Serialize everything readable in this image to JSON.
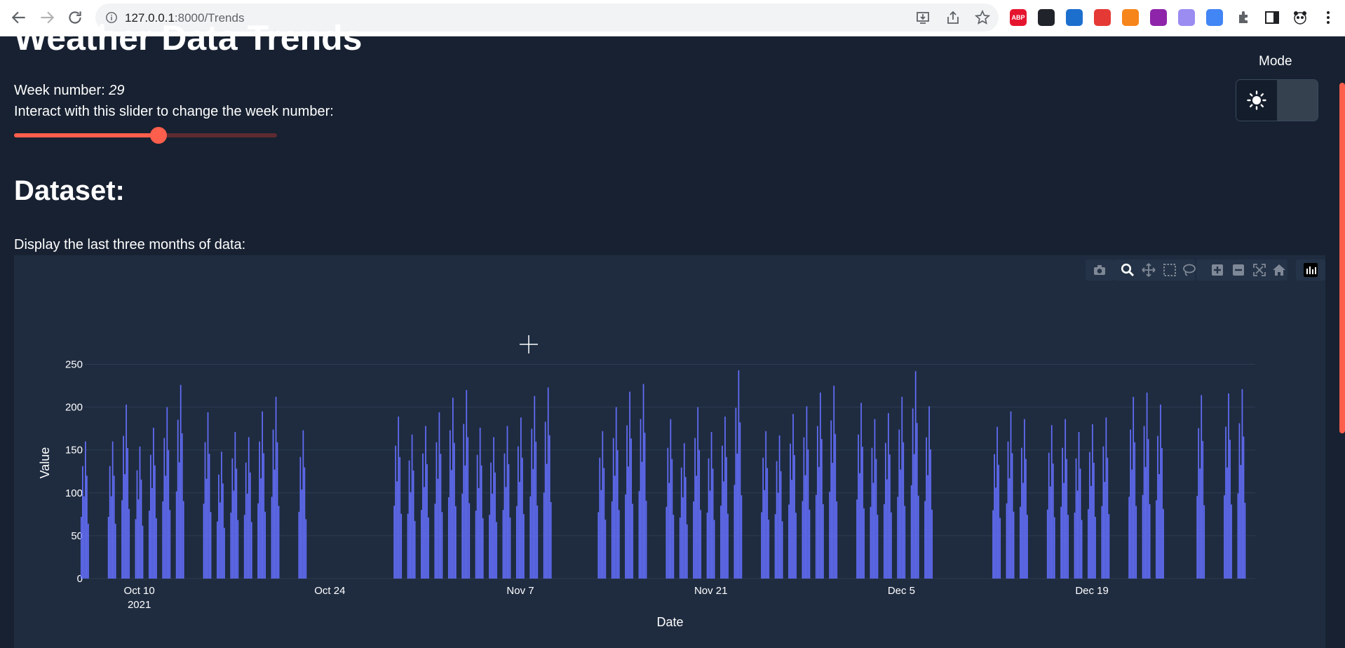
{
  "browser": {
    "url_host": "127.0.0.1",
    "url_path": ":8000/Trends",
    "extensions": [
      {
        "name": "adblock-plus",
        "label": "ABP",
        "color": "#e6152f"
      },
      {
        "name": "react-devtools",
        "label": "",
        "color": "#20232a"
      },
      {
        "name": "shield",
        "label": "",
        "color": "#1d6fce"
      },
      {
        "name": "red-tool",
        "label": "",
        "color": "#e53935"
      },
      {
        "name": "metamask",
        "label": "",
        "color": "#f6851b"
      },
      {
        "name": "purple-square",
        "label": "",
        "color": "#8e24aa"
      },
      {
        "name": "ghost",
        "label": "",
        "color": "#9b8cf2"
      },
      {
        "name": "google-translate",
        "label": "",
        "color": "#4285f4"
      }
    ]
  },
  "page": {
    "title": "Weather Data Trends",
    "week_prefix": "Week number: ",
    "week_number": "29",
    "slider_label": "Interact with this slider to change the week number:",
    "slider_fraction": 0.55,
    "mode_label": "Mode",
    "mode_selected": "dark",
    "section_title": "Dataset:",
    "section_desc": "Display the last three months of data:"
  },
  "colors": {
    "background": "#172131",
    "panel": "#1f2c40",
    "accent": "#fe5e4c",
    "bars": "#636efa"
  },
  "modebar_icons": [
    "camera-icon",
    "zoom-icon",
    "pan-icon",
    "box-select-icon",
    "lasso-icon",
    "zoom-in-icon",
    "zoom-out-icon",
    "autoscale-icon",
    "reset-axes-icon",
    "plotly-logo-icon"
  ],
  "chart_data": {
    "type": "bar",
    "title": "",
    "xlabel": "Date",
    "ylabel": "Value",
    "ylim": [
      0,
      270
    ],
    "xlim": [
      "2021-10-06",
      "2021-12-31"
    ],
    "y_ticks": [
      0,
      50,
      100,
      150,
      200,
      250
    ],
    "x_ticks": [
      {
        "date": "2021-10-10",
        "label": "Oct 10",
        "sublabel": "2021"
      },
      {
        "date": "2021-10-24",
        "label": "Oct 24",
        "sublabel": ""
      },
      {
        "date": "2021-11-07",
        "label": "Nov 7",
        "sublabel": ""
      },
      {
        "date": "2021-11-21",
        "label": "Nov 21",
        "sublabel": ""
      },
      {
        "date": "2021-12-05",
        "label": "Dec 5",
        "sublabel": ""
      },
      {
        "date": "2021-12-19",
        "label": "Dec 19",
        "sublabel": ""
      }
    ],
    "grid": true,
    "series": [
      {
        "color": "#636efa",
        "points": [
          {
            "x": "2021-10-06",
            "y": 160
          },
          {
            "x": "2021-10-08",
            "y": 160
          },
          {
            "x": "2021-10-09",
            "y": 203
          },
          {
            "x": "2021-10-10",
            "y": 154
          },
          {
            "x": "2021-10-11",
            "y": 176
          },
          {
            "x": "2021-10-12",
            "y": 200
          },
          {
            "x": "2021-10-13",
            "y": 226
          },
          {
            "x": "2021-10-15",
            "y": 194
          },
          {
            "x": "2021-10-16",
            "y": 148
          },
          {
            "x": "2021-10-17",
            "y": 171
          },
          {
            "x": "2021-10-18",
            "y": 165
          },
          {
            "x": "2021-10-19",
            "y": 195
          },
          {
            "x": "2021-10-20",
            "y": 212
          },
          {
            "x": "2021-10-22",
            "y": 173
          },
          {
            "x": "2021-10-29",
            "y": 189
          },
          {
            "x": "2021-10-30",
            "y": 168
          },
          {
            "x": "2021-10-31",
            "y": 178
          },
          {
            "x": "2021-11-01",
            "y": 194
          },
          {
            "x": "2021-11-02",
            "y": 211
          },
          {
            "x": "2021-11-03",
            "y": 220
          },
          {
            "x": "2021-11-04",
            "y": 176
          },
          {
            "x": "2021-11-05",
            "y": 165
          },
          {
            "x": "2021-11-06",
            "y": 178
          },
          {
            "x": "2021-11-07",
            "y": 188
          },
          {
            "x": "2021-11-08",
            "y": 213
          },
          {
            "x": "2021-11-09",
            "y": 223
          },
          {
            "x": "2021-11-13",
            "y": 172
          },
          {
            "x": "2021-11-14",
            "y": 200
          },
          {
            "x": "2021-11-15",
            "y": 218
          },
          {
            "x": "2021-11-16",
            "y": 227
          },
          {
            "x": "2021-11-18",
            "y": 186
          },
          {
            "x": "2021-11-19",
            "y": 158
          },
          {
            "x": "2021-11-20",
            "y": 200
          },
          {
            "x": "2021-11-21",
            "y": 171
          },
          {
            "x": "2021-11-22",
            "y": 189
          },
          {
            "x": "2021-11-23",
            "y": 243
          },
          {
            "x": "2021-11-25",
            "y": 172
          },
          {
            "x": "2021-11-26",
            "y": 167
          },
          {
            "x": "2021-11-27",
            "y": 192
          },
          {
            "x": "2021-11-28",
            "y": 201
          },
          {
            "x": "2021-11-29",
            "y": 217
          },
          {
            "x": "2021-11-30",
            "y": 225
          },
          {
            "x": "2021-12-02",
            "y": 205
          },
          {
            "x": "2021-12-03",
            "y": 186
          },
          {
            "x": "2021-12-04",
            "y": 193
          },
          {
            "x": "2021-12-05",
            "y": 212
          },
          {
            "x": "2021-12-06",
            "y": 242
          },
          {
            "x": "2021-12-07",
            "y": 201
          },
          {
            "x": "2021-12-12",
            "y": 177
          },
          {
            "x": "2021-12-13",
            "y": 195
          },
          {
            "x": "2021-12-14",
            "y": 186
          },
          {
            "x": "2021-12-16",
            "y": 179
          },
          {
            "x": "2021-12-17",
            "y": 186
          },
          {
            "x": "2021-12-18",
            "y": 171
          },
          {
            "x": "2021-12-19",
            "y": 180
          },
          {
            "x": "2021-12-20",
            "y": 188
          },
          {
            "x": "2021-12-22",
            "y": 212
          },
          {
            "x": "2021-12-23",
            "y": 217
          },
          {
            "x": "2021-12-24",
            "y": 203
          },
          {
            "x": "2021-12-27",
            "y": 214
          },
          {
            "x": "2021-12-29",
            "y": 216
          },
          {
            "x": "2021-12-30",
            "y": 221
          }
        ]
      }
    ]
  }
}
